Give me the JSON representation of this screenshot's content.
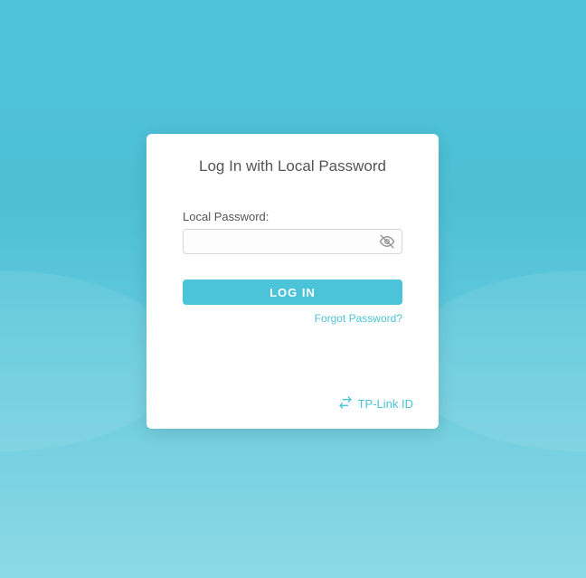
{
  "login": {
    "title": "Log In with Local Password",
    "password_label": "Local Password:",
    "button_label": "LOG IN",
    "forgot_label": "Forgot Password?",
    "footer_link": "TP-Link ID"
  },
  "colors": {
    "accent": "#4bc3d8"
  }
}
